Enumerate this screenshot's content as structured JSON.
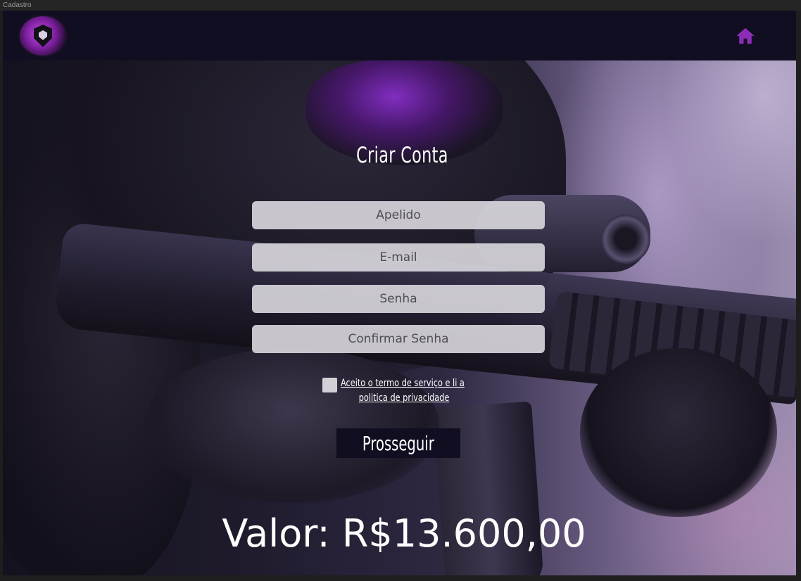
{
  "window": {
    "title": "Cadastro"
  },
  "header": {
    "logo_icon": "shield-logo-icon",
    "home_icon": "home-icon",
    "home_color": "#8e2cb8"
  },
  "form": {
    "title": "Criar Conta",
    "nickname_placeholder": "Apelido",
    "email_placeholder": "E-mail",
    "password_placeholder": "Senha",
    "confirm_password_placeholder": "Confirmar Senha",
    "terms_line1": "Aceito o termo de serviço e li a",
    "terms_line2": "politica de privacidade",
    "terms_checked": false,
    "submit_label": "Prosseguir"
  },
  "price": {
    "label": "Valor: R$13.600,00"
  },
  "colors": {
    "header_bg": "#100e20",
    "button_bg": "#100e20",
    "field_bg": "#dad8de",
    "accent": "#8e2cb8"
  }
}
